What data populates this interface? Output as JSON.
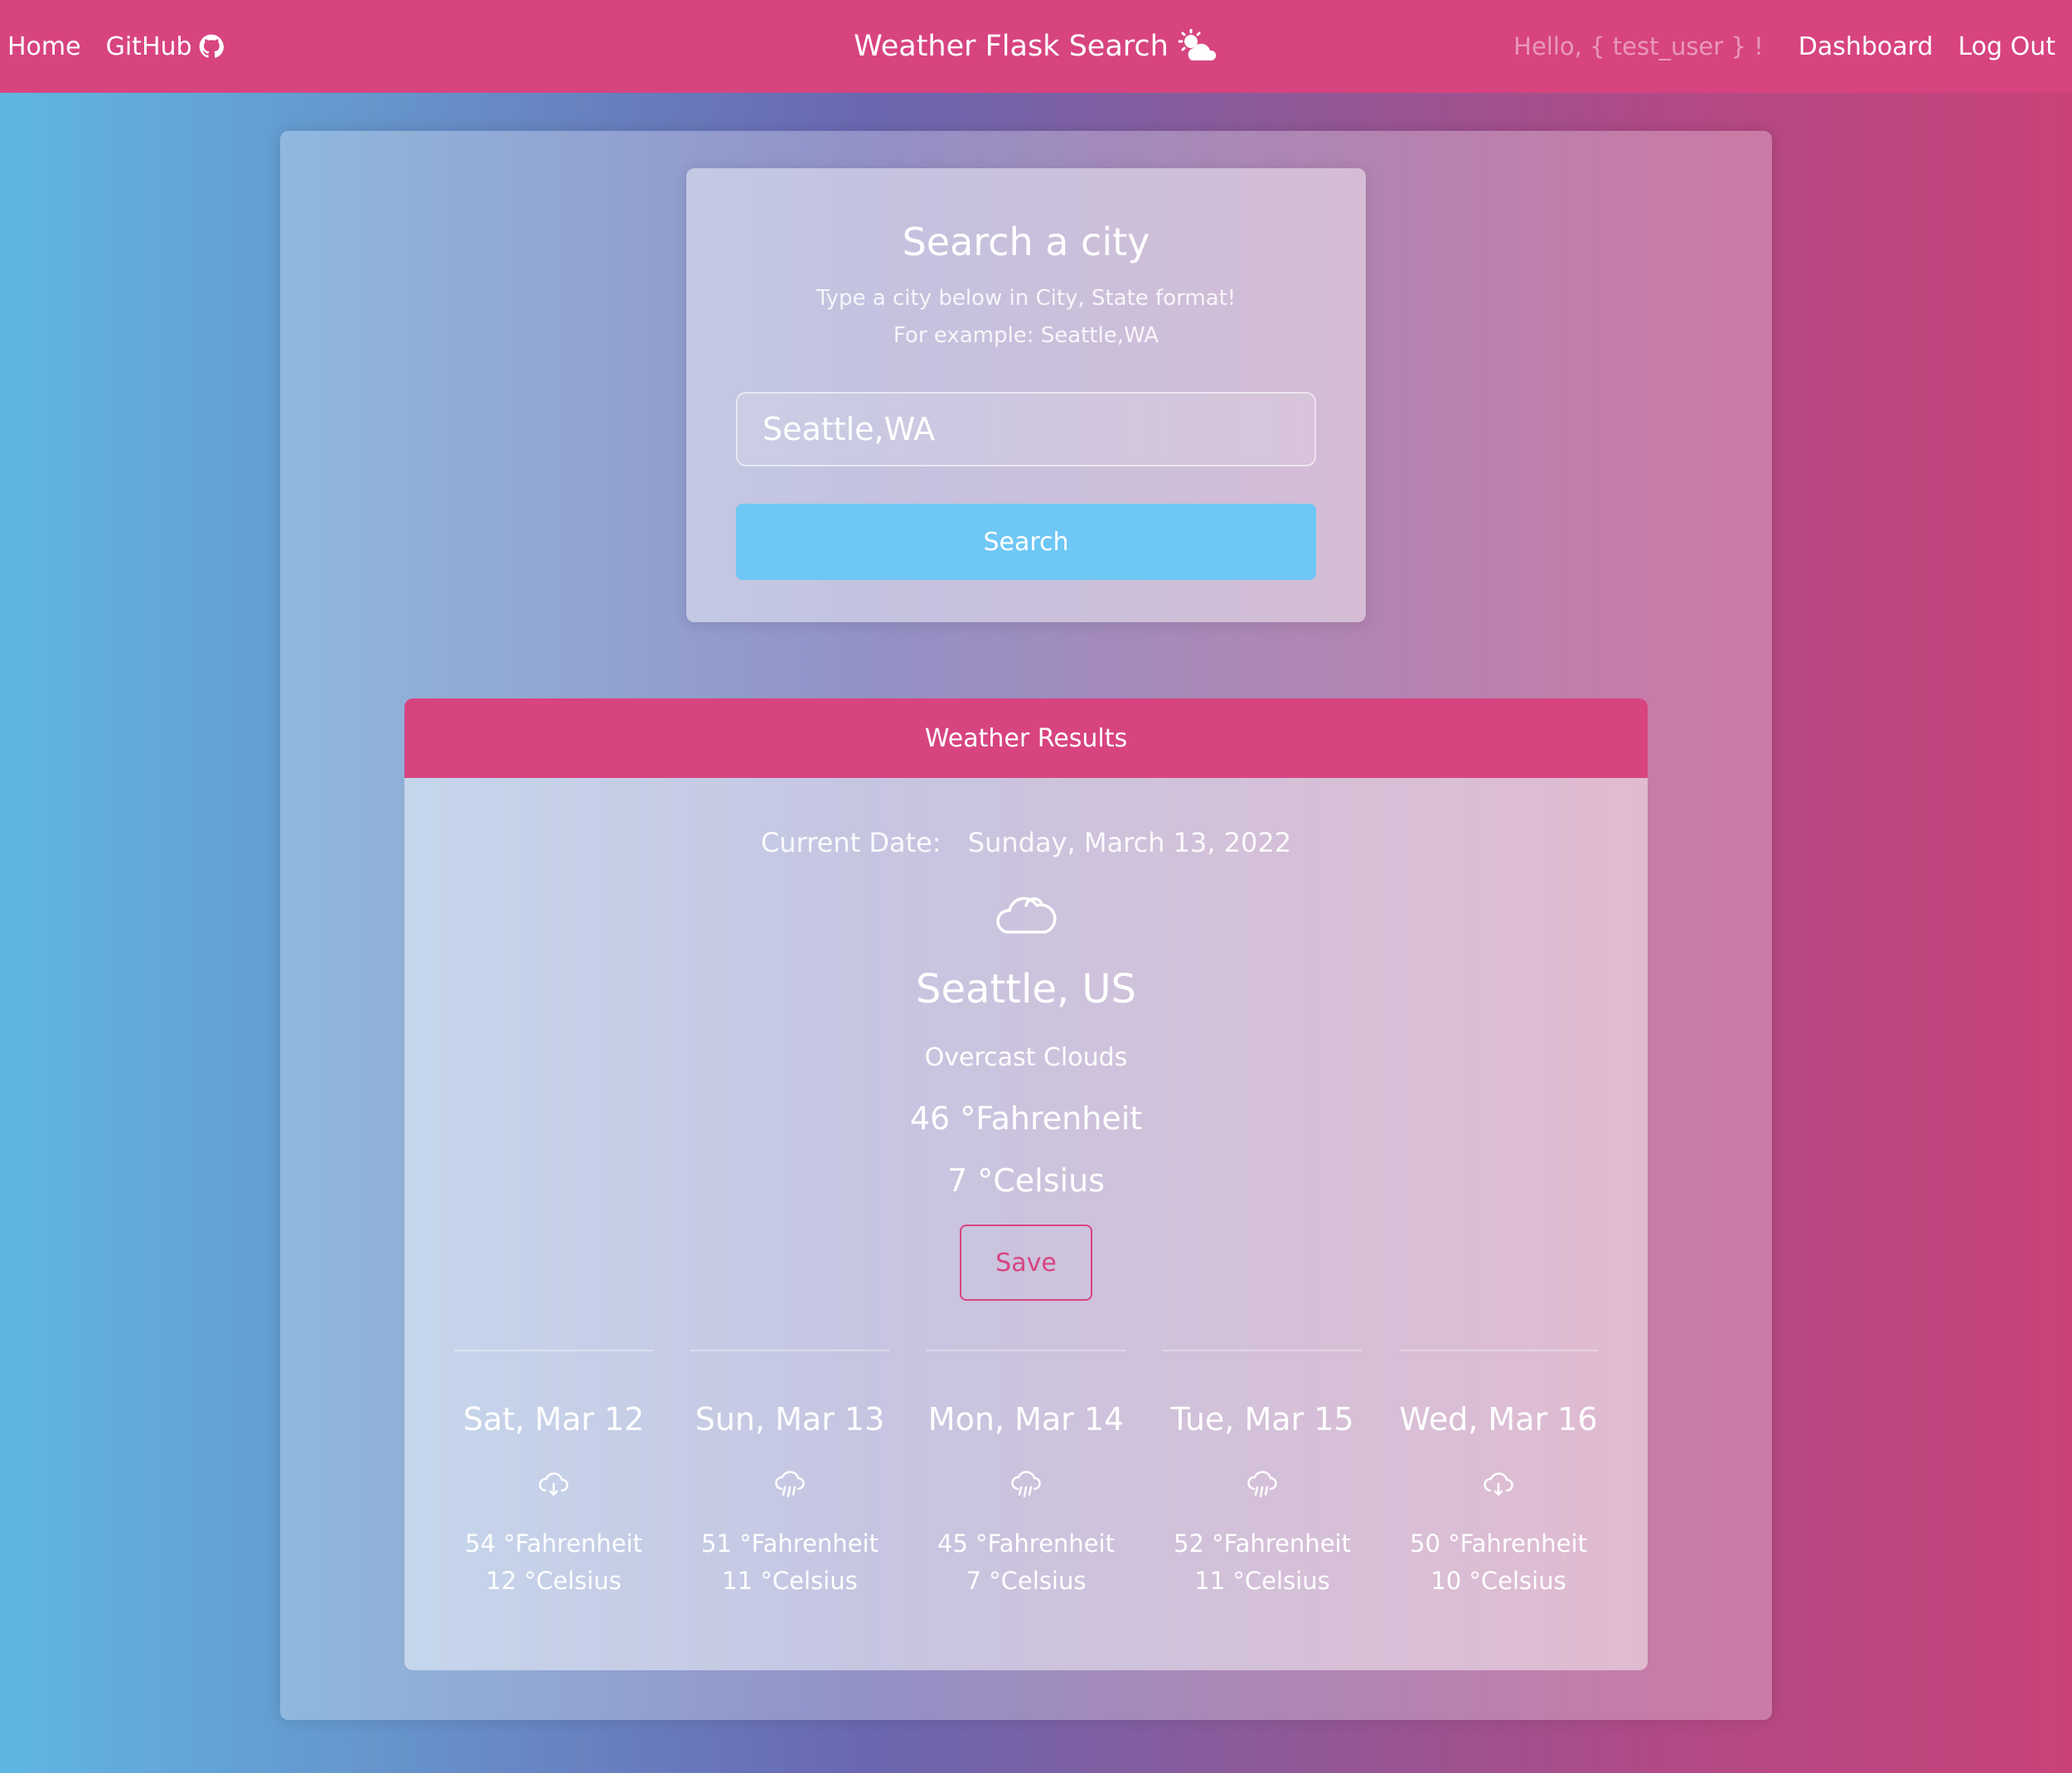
{
  "nav": {
    "home": "Home",
    "github": "GitHub",
    "brand": "Weather Flask Search",
    "greeting": "Hello, { test_user } !",
    "dashboard": "Dashboard",
    "logout": "Log Out"
  },
  "search": {
    "title": "Search a city",
    "subtitle1": "Type a city below in City, State format!",
    "subtitle2": "For example: Seattle,WA",
    "input_value": "Seattle,WA",
    "button": "Search"
  },
  "results": {
    "header": "Weather Results",
    "current_date_label": "Current Date:",
    "current_date": "Sunday, March 13, 2022",
    "icon": "cloud-icon",
    "city": "Seattle, US",
    "description": "Overcast Clouds",
    "temp_f": "46 °Fahrenheit",
    "temp_c": "7 °Celsius",
    "save": "Save",
    "forecast": [
      {
        "day": "Sat, Mar 12",
        "icon": "cloud-download-icon",
        "f": "54 °Fahrenheit",
        "c": "12 °Celsius"
      },
      {
        "day": "Sun, Mar 13",
        "icon": "cloud-rain-icon",
        "f": "51 °Fahrenheit",
        "c": "11 °Celsius"
      },
      {
        "day": "Mon, Mar 14",
        "icon": "cloud-rain-icon",
        "f": "45 °Fahrenheit",
        "c": "7 °Celsius"
      },
      {
        "day": "Tue, Mar 15",
        "icon": "cloud-rain-icon",
        "f": "52 °Fahrenheit",
        "c": "11 °Celsius"
      },
      {
        "day": "Wed, Mar 16",
        "icon": "cloud-download-icon",
        "f": "50 °Fahrenheit",
        "c": "10 °Celsius"
      }
    ]
  },
  "colors": {
    "accent": "#d74480",
    "button": "#6ec7f5"
  }
}
